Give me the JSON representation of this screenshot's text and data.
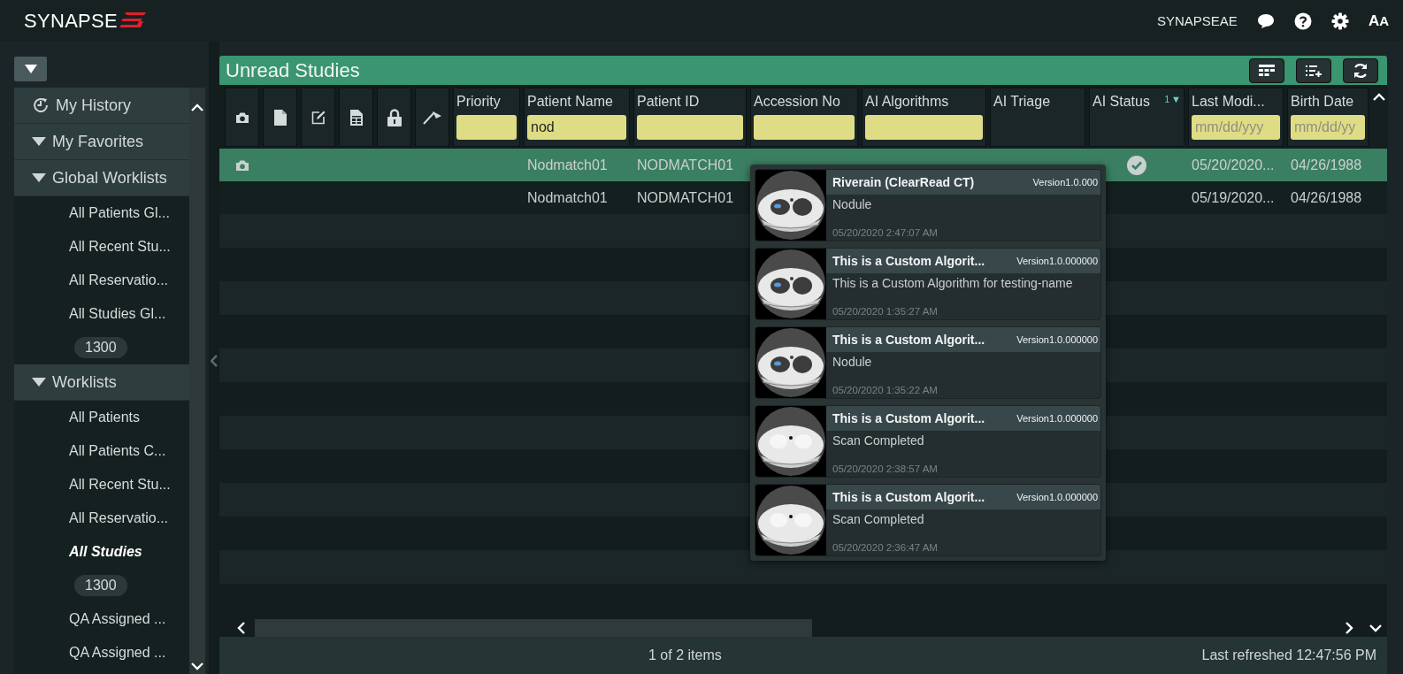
{
  "header": {
    "logo": "SYNAPSE",
    "user": "SYNAPSEAE",
    "font_button": "AA"
  },
  "sidebar": {
    "sections": [
      {
        "label": "My History",
        "kind": "history"
      },
      {
        "label": "My Favorites",
        "kind": "folder"
      },
      {
        "label": "Global Worklists",
        "kind": "folder",
        "items": [
          {
            "label": "All Patients Gl...",
            "selected": false
          },
          {
            "label": "All Recent Stu...",
            "selected": false
          },
          {
            "label": "All Reservatio...",
            "selected": false
          },
          {
            "label": "All Studies Gl...",
            "selected": false
          },
          {
            "badge": "1300"
          }
        ]
      },
      {
        "label": "Worklists",
        "kind": "folder",
        "items": [
          {
            "label": "All Patients",
            "selected": false
          },
          {
            "label": "All Patients C...",
            "selected": false
          },
          {
            "label": "All Recent Stu...",
            "selected": false
          },
          {
            "label": "All Reservatio...",
            "selected": false
          },
          {
            "label": "All Studies",
            "selected": true
          },
          {
            "badge": "1300"
          },
          {
            "label": "QA Assigned ...",
            "selected": false
          },
          {
            "label": "QA Assigned ...",
            "selected": false
          }
        ]
      }
    ]
  },
  "worklist": {
    "title": "Unread Studies",
    "columns": [
      {
        "label": "Priority",
        "kind": "filter"
      },
      {
        "label": "Patient Name",
        "kind": "filter",
        "value": "nod"
      },
      {
        "label": "Patient ID",
        "kind": "filter"
      },
      {
        "label": "Accession No",
        "kind": "filter"
      },
      {
        "label": "AI Algorithms",
        "kind": "filter"
      },
      {
        "label": "AI Triage",
        "kind": "plain"
      },
      {
        "label": "AI Status",
        "kind": "plain",
        "sort_order": "1",
        "sort_arrow": "▼"
      },
      {
        "label": "Last Modi...",
        "kind": "filter",
        "placeholder": "mm/dd/yyy"
      },
      {
        "label": "Birth Date",
        "kind": "filter",
        "placeholder": "mm/dd/yy"
      }
    ],
    "rows": [
      {
        "selected": true,
        "has_images": true,
        "patient_name": "Nodmatch01",
        "patient_id": "NODMATCH01",
        "ai_done": true,
        "last_modified": "05/20/2020...",
        "birth_date": "04/26/1988"
      },
      {
        "selected": false,
        "has_images": false,
        "patient_name": "Nodmatch01",
        "patient_id": "NODMATCH01",
        "ai_done": false,
        "last_modified": "05/19/2020...",
        "birth_date": "04/26/1988"
      }
    ],
    "status": "1 of 2 items",
    "last_refreshed": "Last refreshed 12:47:56 PM"
  },
  "ai_popup": {
    "results": [
      {
        "name": "Riverain (ClearRead CT)",
        "version": "Version1.0.000",
        "finding": "Nodule",
        "time": "05/20/2020 2:47:07 AM",
        "kind": "picture"
      },
      {
        "name": "This is a Custom Algorit...",
        "version": "Version1.0.000000",
        "finding": "This is a Custom Algorithm for testing-name",
        "time": "05/20/2020 1:35:27 AM",
        "kind": "picture"
      },
      {
        "name": "This is a Custom Algorit...",
        "version": "Version1.0.000000",
        "finding": "Nodule",
        "time": "05/20/2020 1:35:22 AM",
        "kind": "picture"
      },
      {
        "name": "This is a Custom Algorit...",
        "version": "Version1.0.000000",
        "finding": "Scan Completed",
        "time": "05/20/2020 2:38:57 AM",
        "kind": "picture"
      },
      {
        "name": "This is a Custom Algorit...",
        "version": "Version1.0.000000",
        "finding": "Scan Completed",
        "time": "05/20/2020 2:36:47 AM",
        "kind": "picture"
      }
    ]
  }
}
